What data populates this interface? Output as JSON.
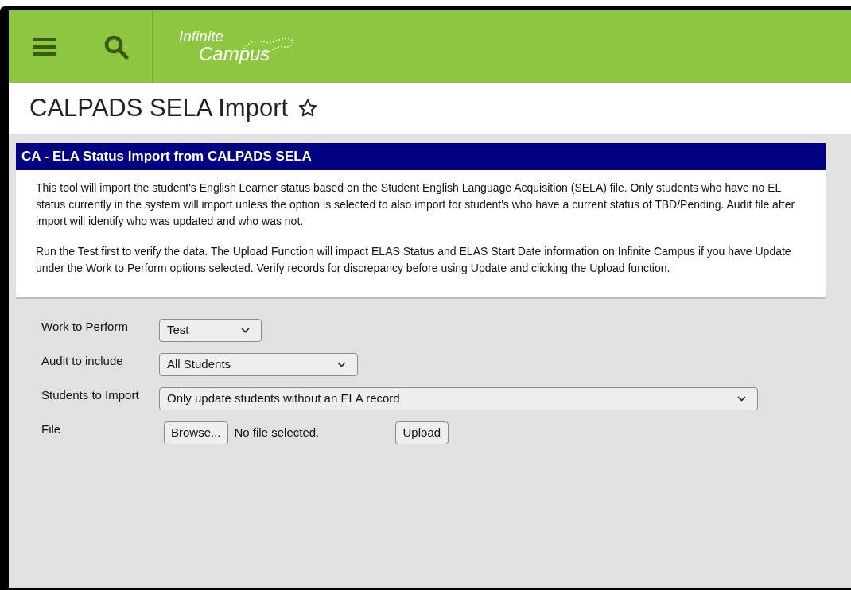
{
  "header": {
    "logo": {
      "line_1": "Infinite",
      "line_2": "Campus"
    }
  },
  "page_title": "CALPADS SELA Import",
  "panel": {
    "title": "CA - ELA Status Import from CALPADS SELA",
    "paragraphs": [
      "This tool will import the student's English Learner status based on the Student English Language Acquisition (SELA) file. Only students who have no EL status currently in the system will import unless the option is selected to also import for student's who have a current status of TBD/Pending. Audit file after import will identify who was updated and who was not.",
      "Run the Test first to verify the data. The Upload Function will impact ELAS Status and ELAS Start Date information on Infinite Campus if you have Update under the Work to Perform options selected. Verify records for discrepancy before using Update and clicking the Upload function."
    ]
  },
  "form": [
    {
      "kind": "select",
      "label": "Work to Perform",
      "value": "Test"
    },
    {
      "kind": "select",
      "label": "Audit to include",
      "value": "All Students"
    },
    {
      "kind": "select",
      "label": "Students to Import",
      "value": "Only update students without an ELA record"
    },
    {
      "kind": "file",
      "label": "File",
      "browse": "Browse...",
      "status": "No file selected.",
      "upload": "Upload"
    }
  ]
}
